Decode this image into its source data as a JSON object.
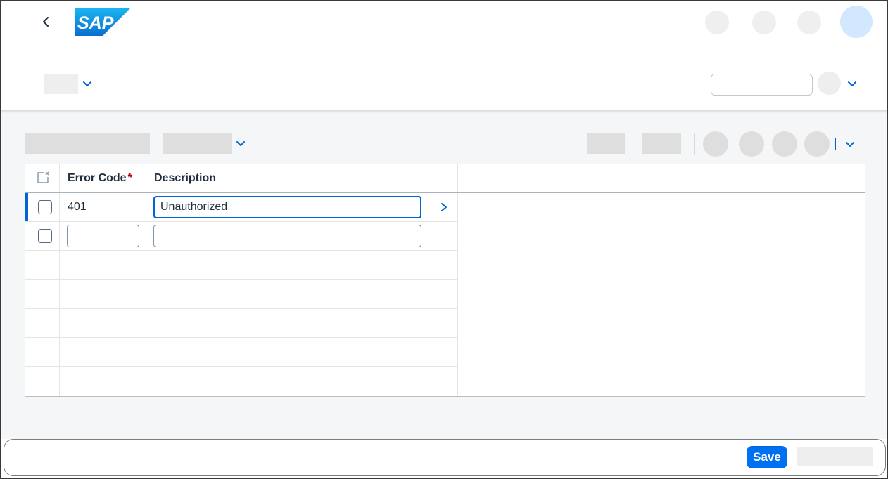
{
  "shell": {
    "logo_text": "SAP",
    "back_icon": "chevron-left-icon",
    "brand_color": "#0070f2"
  },
  "table": {
    "headers": {
      "select_all_icon": "clear-selection-icon",
      "error_code": "Error Code",
      "required_marker": "*",
      "description": "Description"
    },
    "rows": [
      {
        "selected": false,
        "error_code": "401",
        "description": "Unauthorized",
        "focused": true
      },
      {
        "selected": false,
        "error_code": "",
        "description": ""
      }
    ]
  },
  "footer": {
    "save_label": "Save"
  },
  "colors": {
    "accent": "#0070f2",
    "focus": "#0064d9",
    "required": "#aa0808",
    "avatar": "#d1e8ff"
  }
}
